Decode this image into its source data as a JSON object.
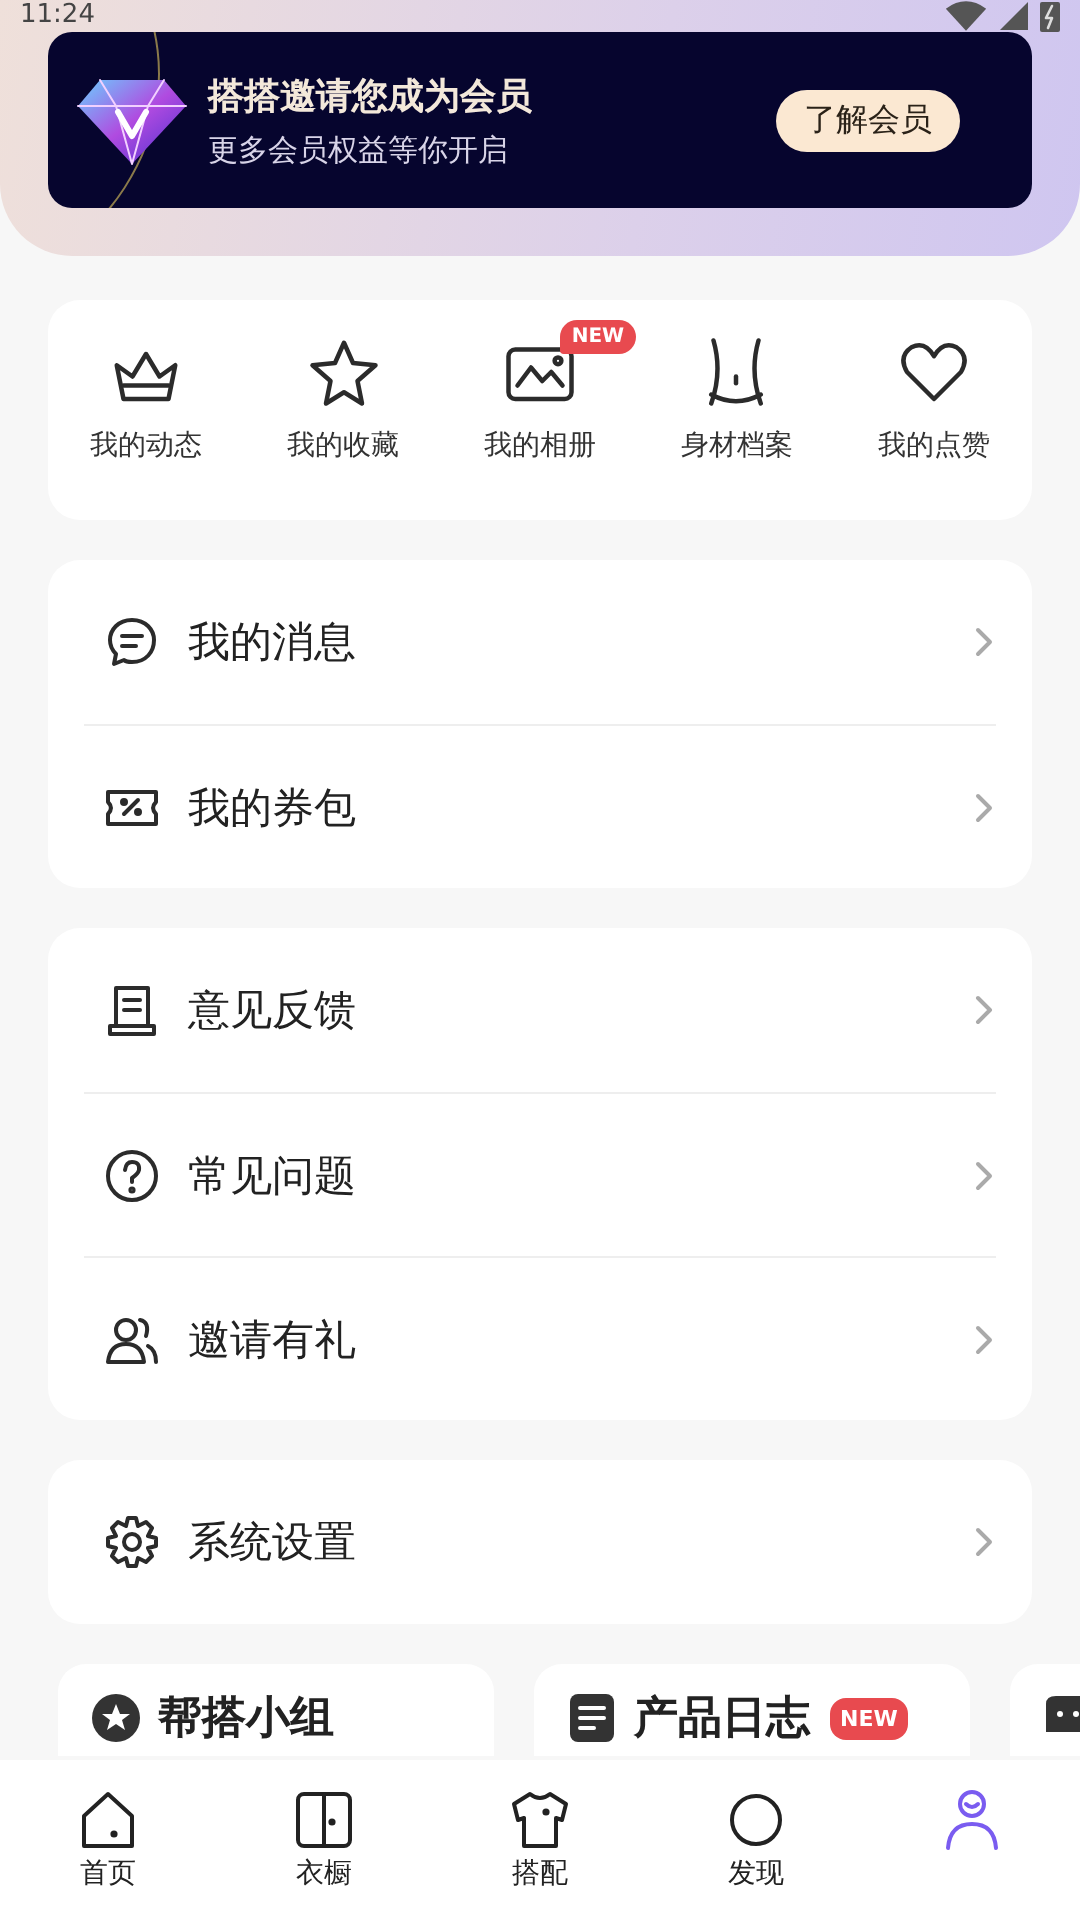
{
  "status_bar": {
    "time": "11:24"
  },
  "member_banner": {
    "title": "搭搭邀请您成为会员",
    "subtitle": "更多会员权益等你开启",
    "button": "了解会员"
  },
  "shortcuts": [
    {
      "label": "我的动态"
    },
    {
      "label": "我的收藏"
    },
    {
      "label": "我的相册",
      "badge": "NEW"
    },
    {
      "label": "身材档案"
    },
    {
      "label": "我的点赞"
    }
  ],
  "menu_groups": [
    [
      {
        "label": "我的消息"
      },
      {
        "label": "我的券包"
      }
    ],
    [
      {
        "label": "意见反馈"
      },
      {
        "label": "常见问题"
      },
      {
        "label": "邀请有礼"
      }
    ],
    [
      {
        "label": "系统设置"
      }
    ]
  ],
  "feature_cards": [
    {
      "kind": "titled",
      "title": "帮搭小组"
    },
    {
      "kind": "titled",
      "title": "产品日志",
      "badge": "NEW"
    },
    {
      "kind": "partial"
    }
  ],
  "tabs": [
    {
      "label": "首页",
      "selected": false
    },
    {
      "label": "衣橱",
      "selected": false
    },
    {
      "label": "搭配",
      "selected": false
    },
    {
      "label": "发现",
      "selected": false
    },
    {
      "selected": true
    }
  ]
}
